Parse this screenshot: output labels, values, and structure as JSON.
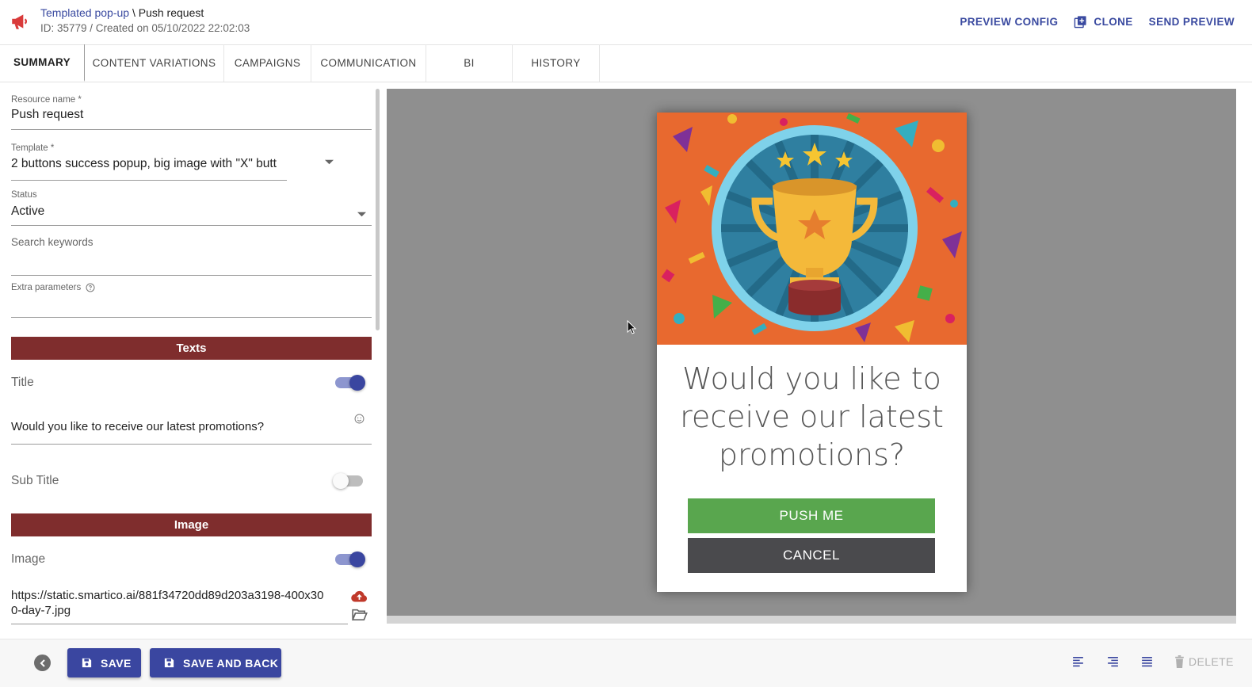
{
  "header": {
    "breadcrumb_parent": "Templated pop-up",
    "breadcrumb_sep": "\\",
    "breadcrumb_current": "Push request",
    "meta": "ID: 35779 / Created on 05/10/2022 22:02:03",
    "actions": {
      "preview_config": "PREVIEW CONFIG",
      "clone": "CLONE",
      "send_preview": "SEND PREVIEW"
    },
    "accent_color": "#3a4aa0",
    "brand_icon": "megaphone-icon",
    "brand_color": "#d93a3a"
  },
  "tabs": [
    "SUMMARY",
    "CONTENT VARIATIONS",
    "CAMPAIGNS",
    "COMMUNICATION",
    "BI",
    "HISTORY"
  ],
  "active_tab": "SUMMARY",
  "form": {
    "resource_name_label": "Resource name *",
    "resource_name_value": "Push request",
    "template_label": "Template *",
    "template_value": "2 buttons success popup, big image with \"X\" butt",
    "status_label": "Status",
    "status_value": "Active",
    "search_keywords_label": "Search keywords",
    "extra_parameters_label": "Extra parameters",
    "texts_section": "Texts",
    "title_label": "Title",
    "title_enabled": true,
    "title_value": "Would you like to receive our latest promotions?",
    "subtitle_label": "Sub Title",
    "subtitle_enabled": false,
    "image_section": "Image",
    "image_label": "Image",
    "image_enabled": true,
    "image_url": "https://static.smartico.ai/881f34720dd89d203a3198-400x300-day-7.jpg",
    "section_color": "#7f2d2d"
  },
  "preview": {
    "title": "Would you like to receive our latest promotions?",
    "primary_button": "PUSH ME",
    "secondary_button": "CANCEL",
    "primary_color": "#59a64e",
    "secondary_color": "#4a4a4d"
  },
  "footer": {
    "save": "SAVE",
    "save_and_back": "SAVE AND BACK",
    "delete": "DELETE"
  }
}
